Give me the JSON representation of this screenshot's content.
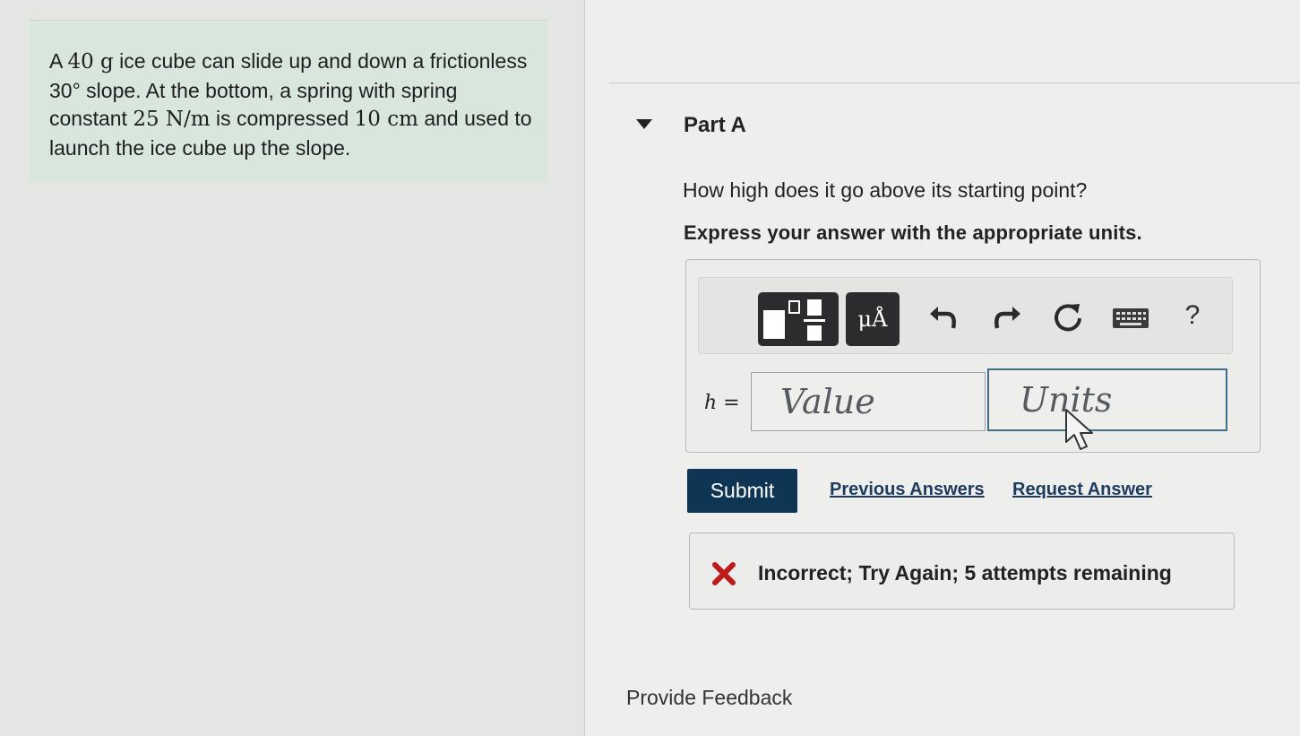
{
  "problem": {
    "text_1": "A ",
    "mass": "40 g",
    "text_2": " ice cube can slide up and down a frictionless ",
    "angle": "30°",
    "text_3": " slope. At the bottom, a spring with spring constant ",
    "spring_constant": "25 N/m",
    "text_4": " is compressed ",
    "compression": "10 cm",
    "text_5": " and used to launch the ice cube up the slope."
  },
  "part": {
    "title": "Part A",
    "question": "How high does it go above its starting point?",
    "instruction": "Express your answer with the appropriate units."
  },
  "toolbar": {
    "units_label": "μÅ",
    "help_label": "?",
    "icons": [
      "fraction-template-icon",
      "units-icon",
      "undo-icon",
      "redo-icon",
      "reset-icon",
      "keyboard-icon",
      "help-icon"
    ]
  },
  "answer": {
    "variable": "h",
    "equals": "=",
    "value_placeholder": "Value",
    "units_placeholder": "Units"
  },
  "actions": {
    "submit_label": "Submit",
    "previous_answers_label": "Previous Answers",
    "request_answer_label": "Request Answer"
  },
  "feedback": {
    "message": "Incorrect; Try Again; 5 attempts remaining",
    "status_color": "#c0191c"
  },
  "footer": {
    "provide_feedback_label": "Provide Feedback"
  },
  "colors": {
    "submit_bg": "#0f3554",
    "link": "#1d3b5e",
    "units_border": "#3f6f88"
  }
}
